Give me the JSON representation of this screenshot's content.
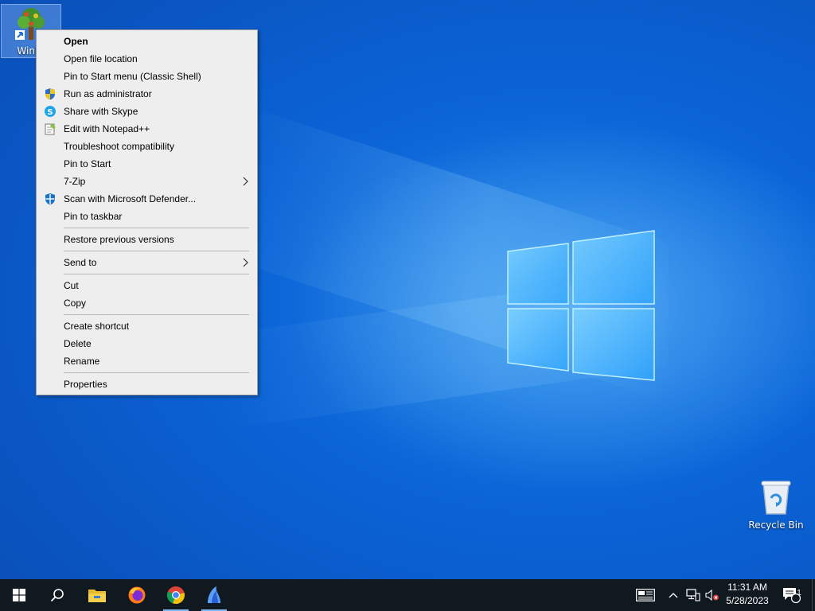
{
  "desktop": {
    "icons": [
      {
        "label": "WinDi",
        "icon": "tree-shortcut-icon"
      },
      {
        "label": "Recycle Bin",
        "icon": "recycle-bin-icon"
      }
    ]
  },
  "context_menu": {
    "items": [
      {
        "label": "Open",
        "bold": true
      },
      {
        "label": "Open file location"
      },
      {
        "label": "Pin to Start menu (Classic Shell)"
      },
      {
        "label": "Run as administrator",
        "icon": "uac-shield-icon"
      },
      {
        "label": "Share with Skype",
        "icon": "skype-icon"
      },
      {
        "label": "Edit with Notepad++",
        "icon": "notepad-plus-plus-icon"
      },
      {
        "label": "Troubleshoot compatibility"
      },
      {
        "label": "Pin to Start"
      },
      {
        "label": "7-Zip",
        "submenu": true
      },
      {
        "label": "Scan with Microsoft Defender...",
        "icon": "defender-icon"
      },
      {
        "label": "Pin to taskbar"
      },
      {
        "label": "Restore previous versions"
      },
      {
        "label": "Send to",
        "submenu": true
      },
      {
        "label": "Cut"
      },
      {
        "label": "Copy"
      },
      {
        "label": "Create shortcut"
      },
      {
        "label": "Delete"
      },
      {
        "label": "Rename"
      },
      {
        "label": "Properties"
      }
    ]
  },
  "taskbar": {
    "apps": [
      "start-icon",
      "search-icon",
      "file-explorer-icon",
      "firefox-icon",
      "chrome-icon",
      "windirstat-icon"
    ],
    "tray_icons": [
      "news-and-interests-icon",
      "chevron-up-icon",
      "network-icon",
      "volume-muted-icon"
    ],
    "clock": {
      "time": "11:31 AM",
      "date": "5/28/2023"
    },
    "notifications": {
      "count": "1"
    }
  },
  "colors": {
    "desktop": "#0b63d6",
    "taskbar": "#101820",
    "menu_background": "#eeeeee",
    "accent": "#7fb8f0"
  }
}
